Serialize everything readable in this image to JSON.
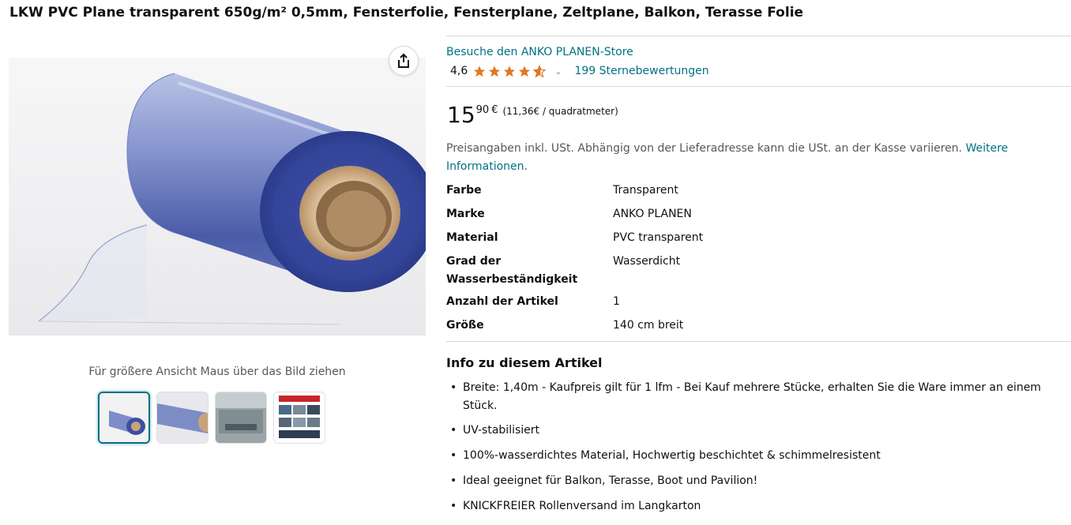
{
  "product": {
    "title": "LKW PVC Plane transparent 650g/m² 0,5mm, Fensterfolie, Fensterplane, Zeltplane, Balkon, Terasse Folie",
    "store_link": "Besuche den ANKO PLANEN-Store",
    "rating": "4,6",
    "rating_stars_value": 4.6,
    "ratings_count": "199 Sternebewertungen",
    "price": {
      "whole": "15",
      "fraction": "90",
      "currency": "€",
      "unit_price": "(11,36€ / quadratmeter)"
    },
    "tax_note": "Preisangaben inkl. USt. Abhängig von der Lieferadresse kann die USt. an der Kasse variieren.",
    "tax_link": "Weitere Informationen."
  },
  "gallery": {
    "hover_hint": "Für größere Ansicht Maus über das Bild ziehen",
    "thumb_count": 4,
    "selected_thumb": 0
  },
  "specs": [
    {
      "key": "Farbe",
      "value": "Transparent"
    },
    {
      "key": "Marke",
      "value": "ANKO PLANEN"
    },
    {
      "key": "Material",
      "value": "PVC transparent"
    },
    {
      "key": "Grad der Wasserbeständigkeit",
      "value": "Wasserdicht"
    },
    {
      "key": "Anzahl der Artikel",
      "value": "1"
    },
    {
      "key": "Größe",
      "value": "140 cm breit"
    }
  ],
  "about": {
    "title": "Info zu diesem Artikel",
    "bullets": [
      "Breite: 1,40m - Kaufpreis gilt für 1 lfm - Bei Kauf mehrere Stücke, erhalten Sie die Ware immer an einem Stück.",
      "UV-stabilisiert",
      "100%-wasserdichtes Material, Hochwertig beschichtet & schimmelresistent",
      "Ideal geeignet für Balkon, Terasse, Boot und Pavilion!",
      "KNICKFREIER Rollenversand im Langkarton"
    ]
  },
  "colors": {
    "link": "#007185",
    "star": "#de7921",
    "text": "#0f1111",
    "muted": "#565959"
  },
  "icons": {
    "share": "share-icon",
    "star": "star-icon",
    "caret": "chevron-down-icon"
  }
}
